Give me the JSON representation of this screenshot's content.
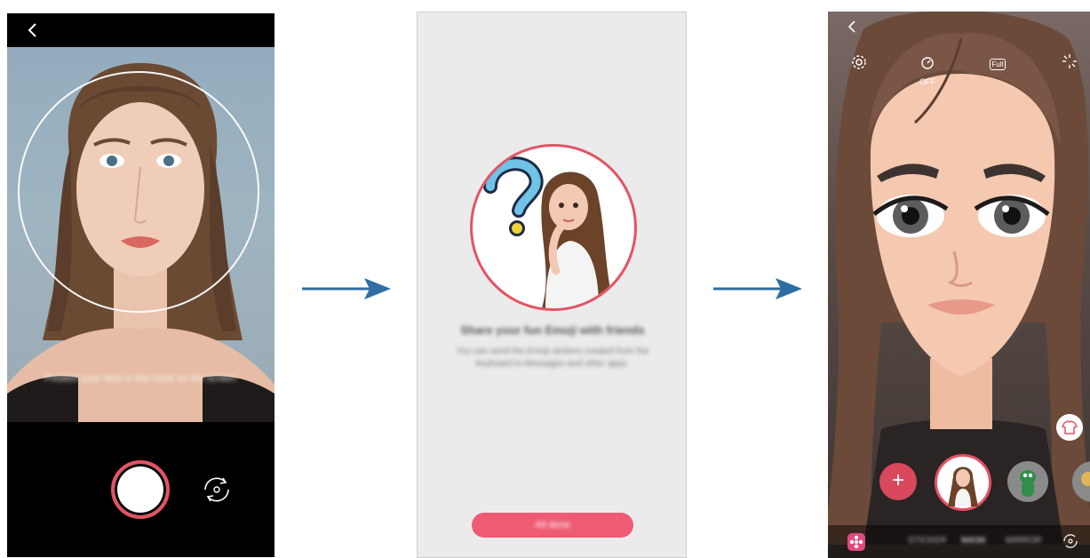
{
  "phone1": {
    "back_icon": "chevron-left-icon",
    "hint_text": "Position your face in the circle on the screen",
    "shutter_icon": "shutter-button",
    "flip_icon": "switch-camera-icon"
  },
  "arrows": {
    "color": "#2f6ea3"
  },
  "phone2": {
    "title_text": "Share your fun Emoji with friends",
    "body_text": "You can send the Emoji stickers created from the keyboard in Messages and other apps.",
    "cta_label": "All done"
  },
  "phone3": {
    "back_icon": "chevron-left-icon",
    "top_icons": [
      "settings-icon",
      "timer-off-icon",
      "full-ratio-icon",
      "effects-icon"
    ],
    "timer_label": "OFF",
    "ratio_label": "Full",
    "add_label": "+",
    "mode_tabs": [
      "STICKER",
      "MASK",
      "MIRROR"
    ],
    "accent": "#e45364"
  }
}
